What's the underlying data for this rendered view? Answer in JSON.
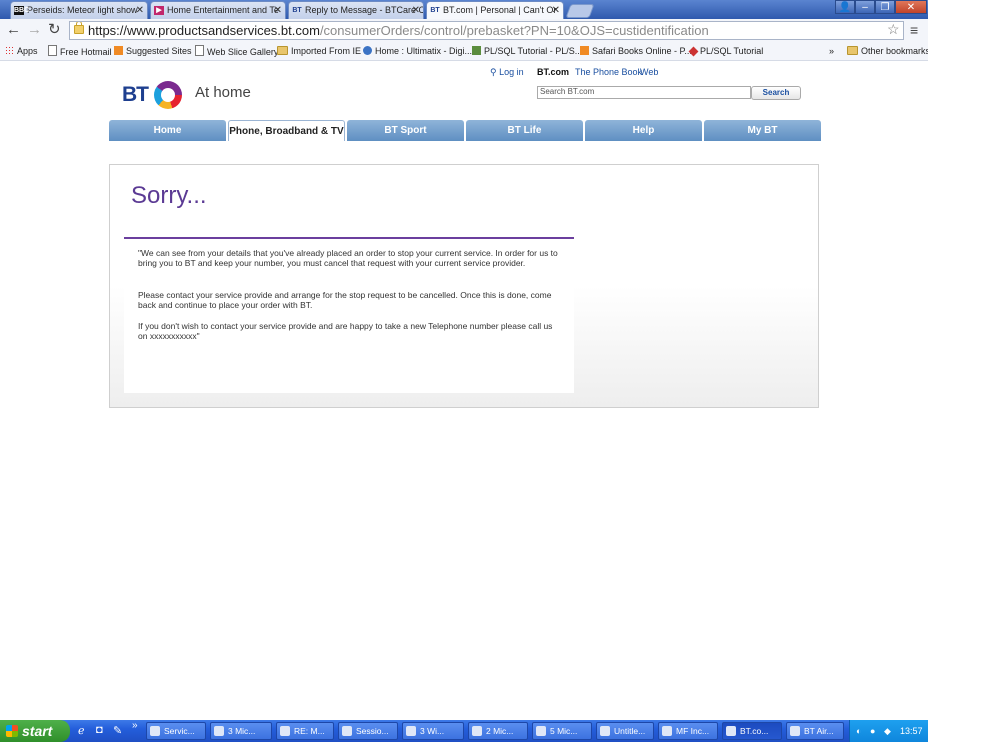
{
  "browser": {
    "tabs": [
      {
        "label": "Perseids: Meteor light show",
        "favicon": "BBC"
      },
      {
        "label": "Home Entertainment and Te",
        "favicon": "▶"
      },
      {
        "label": "Reply to Message - BTCare C",
        "favicon": "BT"
      },
      {
        "label": "BT.com | Personal | Can't Or",
        "favicon": "BT",
        "active": true
      }
    ],
    "url_host": "https://www.productsandservices.bt.com",
    "url_path": "/consumerOrders/control/prebasket?PN=10&OJS=custidentification",
    "bookmarks": [
      "Apps",
      "Free Hotmail",
      "Suggested Sites",
      "Web Slice Gallery",
      "Imported From IE",
      "Home : Ultimatix - Digi...",
      "PL/SQL Tutorial - PL/S...",
      "Safari Books Online - P...",
      "PL/SQL Tutorial",
      "»",
      "Other bookmarks"
    ]
  },
  "site": {
    "login": "Log in",
    "links": [
      "BT.com",
      "The Phone Book",
      "Web"
    ],
    "logo_text": "BT",
    "tagline": "At home",
    "search_placeholder": "Search BT.com",
    "search_button": "Search",
    "nav": [
      "Home",
      "Phone, Broadband & TV",
      "BT Sport",
      "BT Life",
      "Help",
      "My BT"
    ],
    "active_nav": "Phone, Broadband & TV"
  },
  "content": {
    "heading": "Sorry...",
    "paragraphs": [
      "\"We can see from your details that you've already placed an order to stop your current service. In order for us to bring you to BT and keep your number, you must cancel that request with your current service provider.",
      "Please contact your service provide and arrange for the stop request to be cancelled. Once this is done, come back and continue to place your order with BT.",
      "If you don't wish to contact your service provide and are happy to take a new Telephone number please call us on xxxxxxxxxxx\""
    ]
  },
  "taskbar": {
    "start": "start",
    "tasks": [
      "Servic...",
      "3 Mic...",
      "RE: M...",
      "Sessio...",
      "3 Wi...",
      "2 Mic...",
      "5 Mic...",
      "Untitle...",
      "MF Inc...",
      "BT.co...",
      "BT Air..."
    ],
    "clock": "13:57"
  },
  "colors": {
    "bt_purple": "#5b3a94",
    "bt_blue": "#1e3f8f",
    "nav_blue": "#6f9bcc"
  }
}
